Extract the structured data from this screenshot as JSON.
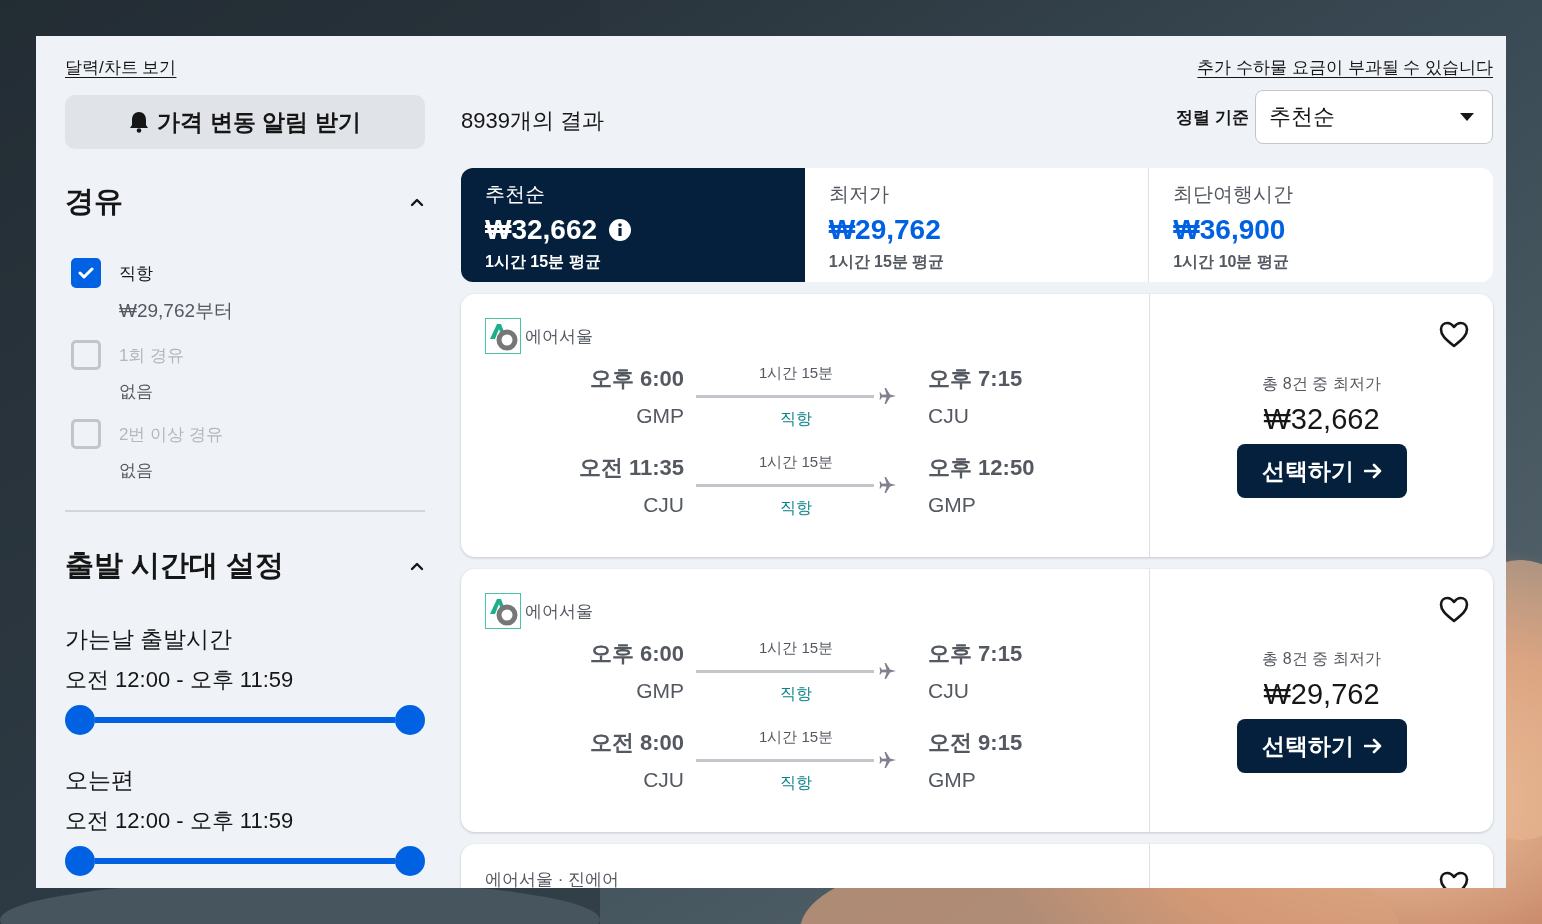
{
  "links": {
    "calendar": "달력/차트 보기",
    "baggage": "추가 수하물 요금이 부과될 수 있습니다"
  },
  "price_alert_button": "가격 변동 알림 받기",
  "stops_filter": {
    "title": "경유",
    "expanded": true,
    "options": [
      {
        "label": "직항",
        "detail": "₩29,762부터",
        "checked": true,
        "disabled": false
      },
      {
        "label": "1회 경유",
        "detail": "없음",
        "checked": false,
        "disabled": true
      },
      {
        "label": "2번 이상 경유",
        "detail": "없음",
        "checked": false,
        "disabled": true
      }
    ]
  },
  "time_filter": {
    "title": "출발 시간대 설정",
    "expanded": true,
    "ranges": [
      {
        "label": "가는날 출발시간",
        "range": "오전 12:00 - 오후 11:59",
        "level": 1
      },
      {
        "label": "오는편",
        "range": "오전 12:00 - 오후 11:59",
        "level": 1
      }
    ]
  },
  "results_count": "8939개의 결과",
  "sort": {
    "label": "정렬 기준",
    "value": "추천순"
  },
  "sort_tabs": [
    {
      "title": "추천순",
      "price": "₩32,662",
      "duration": "1시간 15분 평균",
      "selected": true,
      "info": true
    },
    {
      "title": "최저가",
      "price": "₩29,762",
      "duration": "1시간 15분 평균",
      "selected": false,
      "info": false
    },
    {
      "title": "최단여행시간",
      "price": "₩36,900",
      "duration": "1시간 10분 평균",
      "selected": false,
      "info": false
    }
  ],
  "results": [
    {
      "airline": "에어서울",
      "logo": true,
      "favorite": false,
      "legs": [
        {
          "depart_time": "오후 6:00",
          "depart_airport": "GMP",
          "duration": "1시간 15분",
          "stops": "직항",
          "arrive_time": "오후 7:15",
          "arrive_airport": "CJU"
        },
        {
          "depart_time": "오전 11:35",
          "depart_airport": "CJU",
          "duration": "1시간 15분",
          "stops": "직항",
          "arrive_time": "오후 12:50",
          "arrive_airport": "GMP"
        }
      ],
      "price_note": "총 8건 중 최저가",
      "price": "₩32,662",
      "button": "선택하기"
    },
    {
      "airline": "에어서울",
      "logo": true,
      "favorite": false,
      "legs": [
        {
          "depart_time": "오후 6:00",
          "depart_airport": "GMP",
          "duration": "1시간 15분",
          "stops": "직항",
          "arrive_time": "오후 7:15",
          "arrive_airport": "CJU"
        },
        {
          "depart_time": "오전 8:00",
          "depart_airport": "CJU",
          "duration": "1시간 15분",
          "stops": "직항",
          "arrive_time": "오전 9:15",
          "arrive_airport": "GMP"
        }
      ],
      "price_note": "총 8건 중 최저가",
      "price": "₩29,762",
      "button": "선택하기"
    },
    {
      "airline": "에어서울 · 진에어",
      "logo": false,
      "favorite": false
    }
  ]
}
